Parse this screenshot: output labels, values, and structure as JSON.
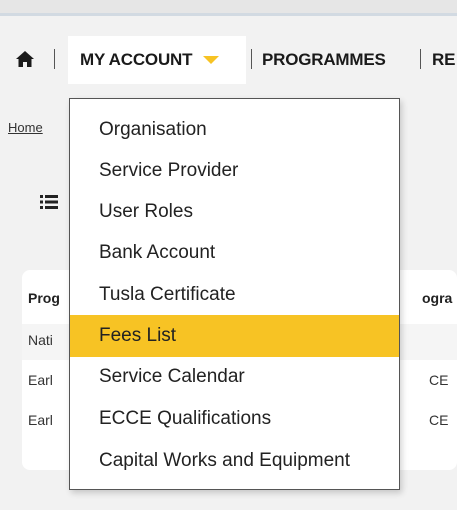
{
  "navbar": {
    "home_icon": "home-icon",
    "items": [
      {
        "label": "MY ACCOUNT"
      },
      {
        "label": "PROGRAMMES"
      },
      {
        "label": "RE"
      }
    ],
    "chevron_icon": "chevron-down-icon",
    "chevron_color": "#f7c324"
  },
  "breadcrumb": {
    "label": "Home"
  },
  "toolbar": {
    "list_icon": "list-icon"
  },
  "table": {
    "headers": [
      "Prog",
      "ogra"
    ],
    "rows": [
      [
        "Nati",
        ""
      ],
      [
        "Earl",
        "CE"
      ],
      [
        "Earl",
        "CE"
      ]
    ]
  },
  "dropdown": {
    "items": [
      {
        "label": "Organisation"
      },
      {
        "label": "Service Provider"
      },
      {
        "label": "User Roles"
      },
      {
        "label": "Bank Account"
      },
      {
        "label": "Tusla Certificate"
      },
      {
        "label": "Fees List",
        "selected": true
      },
      {
        "label": "Service Calendar"
      },
      {
        "label": "ECCE Qualifications"
      },
      {
        "label": "Capital Works and Equipment"
      }
    ],
    "highlight_color": "#f7c324"
  }
}
